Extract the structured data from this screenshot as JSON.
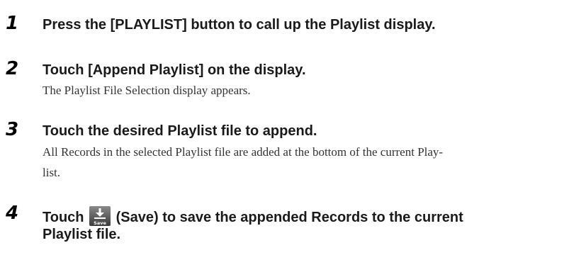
{
  "steps": [
    {
      "number": "1",
      "heading": "Press the [PLAYLIST] button to call up the Playlist display."
    },
    {
      "number": "2",
      "heading": "Touch [Append Playlist] on the display.",
      "body": "The Playlist File Selection display appears."
    },
    {
      "number": "3",
      "heading": "Touch the desired Playlist file to append.",
      "body_line1": "All Records in the selected Playlist file are added at the bottom of the current Play-",
      "body_line2": "list."
    },
    {
      "number": "4",
      "heading_before_icon": "Touch",
      "icon_label": "Save",
      "heading_after_icon": "(Save) to save the appended Records to the current",
      "heading_line2": "Playlist file."
    }
  ],
  "icon": "save-download-icon"
}
